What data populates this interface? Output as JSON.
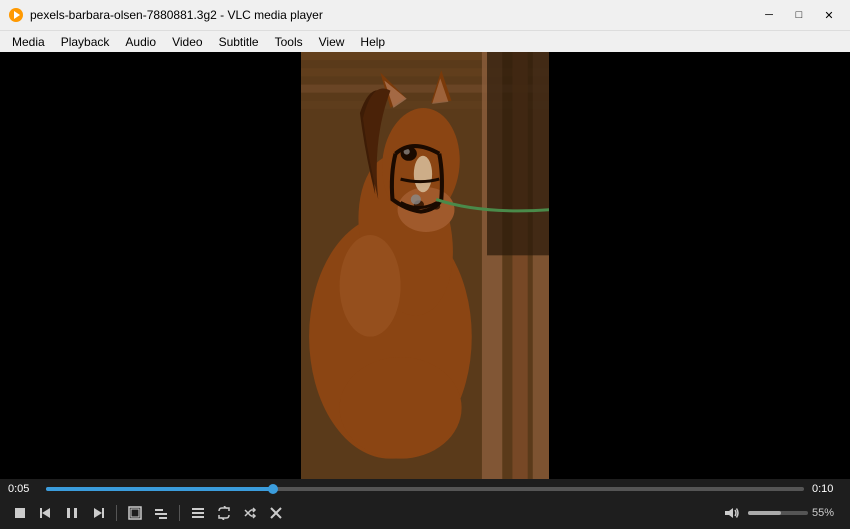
{
  "titlebar": {
    "icon": "▶",
    "title": "pexels-barbara-olsen-7880881.3g2 - VLC media player",
    "minimize_label": "─",
    "maximize_label": "□",
    "close_label": "✕"
  },
  "menubar": {
    "items": [
      "Media",
      "Playback",
      "Audio",
      "Video",
      "Subtitle",
      "Tools",
      "View",
      "Help"
    ]
  },
  "player": {
    "current_time": "0:05",
    "total_time": "0:10",
    "progress_percent": 30,
    "volume_percent": 55,
    "volume_label": "55%"
  },
  "controls": {
    "stop_label": "■",
    "prev_label": "⏮",
    "play_label": "⏸",
    "next_label": "⏭",
    "fullscreen_label": "⛶",
    "extended_label": "⧉",
    "playlist_label": "☰",
    "loop_label": "↻",
    "random_label": "⇄",
    "snap_label": "✕",
    "volume_icon": "🔊"
  }
}
